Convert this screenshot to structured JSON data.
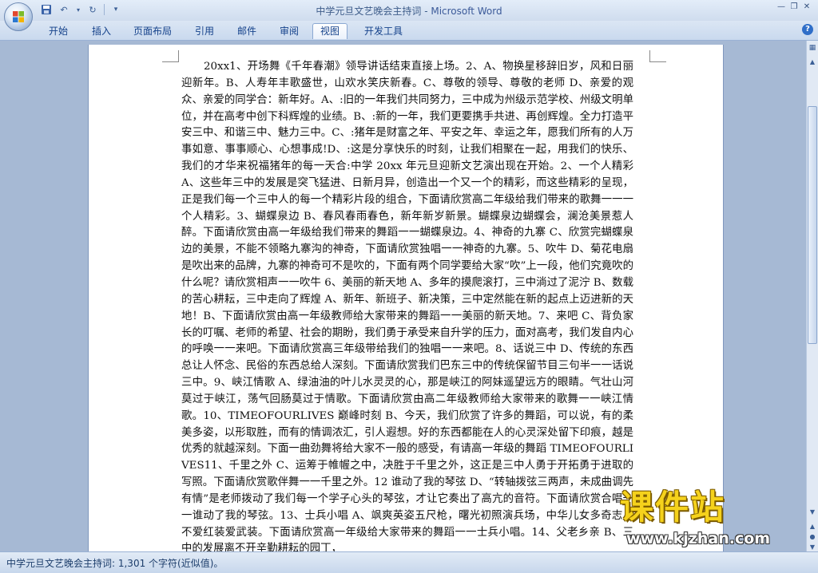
{
  "window": {
    "title_doc": "中学元旦文艺晚会主持词",
    "title_sep": " - ",
    "title_app": "Microsoft Word"
  },
  "ribbon": {
    "tabs": [
      {
        "label": "开始"
      },
      {
        "label": "插入"
      },
      {
        "label": "页面布局"
      },
      {
        "label": "引用"
      },
      {
        "label": "邮件"
      },
      {
        "label": "审阅"
      },
      {
        "label": "视图",
        "active": true
      },
      {
        "label": "开发工具"
      }
    ]
  },
  "document": {
    "body": "20xx1、开场舞《千年春潮》领导讲话结束直接上场。2、A、物换星移辞旧岁，风和日丽迎新年。B、人寿年丰歌盛世，山欢水笑庆新春。C、尊敬的领导、尊敬的老师 D、亲爱的观众、亲爱的同学合：新年好。A、:旧的一年我们共同努力，三中成为州级示范学校、州级文明单位，并在高考中创下科辉煌的业绩。B、:新的一年，我们更要携手共进、再创辉煌。全力打造平安三中、和谐三中、魅力三中。C、:猪年是财富之年、平安之年、幸运之年，愿我们所有的人万事如意、事事顺心、心想事成!D、:这是分享快乐的时刻，让我们相聚在一起，用我们的快乐、我们的才华来祝福猪年的每一天合:中学 20xx 年元旦迎新文艺演出现在开始。2、一个人精彩 A、这些年三中的发展是突飞猛进、日新月异，创造出一个又一个的精彩，而这些精彩的呈现，正是我们每一个三中人的每一个精彩片段的组合，下面请欣赏高二年级给我们带来的歌舞一一一个人精彩。3、蝴蝶泉边 B、春风春雨春色，新年新岁新景。蝴蝶泉边蝴蝶会，澜沧美景惹人醉。下面请欣赏由高一年级给我们带来的舞蹈一一蝴蝶泉边。4、神奇的九寨 C、欣赏完蝴蝶泉边的美景，不能不领略九寨沟的神奇，下面请欣赏独唱一一神奇的九寨。5、吹牛 D、菊花电扇是吹出来的品牌，九寨的神奇可不是吹的，下面有两个同学要给大家“吹”上一段，他们究竟吹的什么呢？请欣赏相声一一吹牛 6、美丽的新天地 A、多年的摸爬滚打，三中淌过了泥泞 B、数载的苦心耕耘，三中走向了辉煌 A、新年、新班子、新决策，三中定然能在新的起点上迈进新的天地！B、下面请欣赏由高一年级教师给大家带来的舞蹈一一美丽的新天地。7、来吧 C、背负家长的叮嘱、老师的希望、社会的期盼，我们勇于承受来自升学的压力，面对高考，我们发自内心的呼唤一一来吧。下面请欣赏高三年级带给我们的独唱一一来吧。8、话说三中 D、传统的东西总让人怀念、民俗的东西总给人深刻。下面请欣赏我们巴东三中的传统保留节目三句半一一话说三中。9、峡江情歌 A、绿油油的叶儿水灵灵的心，那是峡江的阿妹遥望远方的眼睛。气壮山河莫过于峡江，荡气回肠莫过于情歌。下面请欣赏由高二年级教师给大家带来的歌舞一一峡江情歌。10、TIMEOFOURLIVES 巅峰时刻 B、今天，我们欣赏了许多的舞蹈，可以说，有的柔美多姿，以形取胜，而有的情调浓汇，引人遐想。好的东西都能在人的心灵深处留下印痕，越是优秀的就越深刻。下面一曲劲舞将给大家不一般的感受，有请高一年级的舞蹈 TIMEOFOURLIVES11、千里之外 C、运筹于帷幄之中，决胜于千里之外，这正是三中人勇于开拓勇于进取的写照。下面请欣赏歌伴舞一一千里之外。12 谁动了我的琴弦 D、“转轴拨弦三两声，未成曲调先有情”是老师拨动了我们每一个学子心头的琴弦，才让它奏出了高亢的音符。下面请欣赏合唱一一谁动了我的琴弦。13、士兵小唱 A、飒爽英姿五尺枪，曙光初照演兵场，中华儿女多奇志，不爱红装爱武装。下面请欣赏高一年级给大家带来的舞蹈一一士兵小唱。14、父老乡亲 B、三中的发展离不开辛勤耕耘的园丁，"
  },
  "status": {
    "text": "中学元旦文艺晚会主持词: 1,301 个字符(近似值)。"
  },
  "watermark": {
    "brand": "课件站",
    "url": "www.kjzhan.com"
  },
  "colors": {
    "ribbon_text": "#15428b",
    "workspace": "#a6b9d4",
    "watermark_yellow": "#f5d21c"
  }
}
